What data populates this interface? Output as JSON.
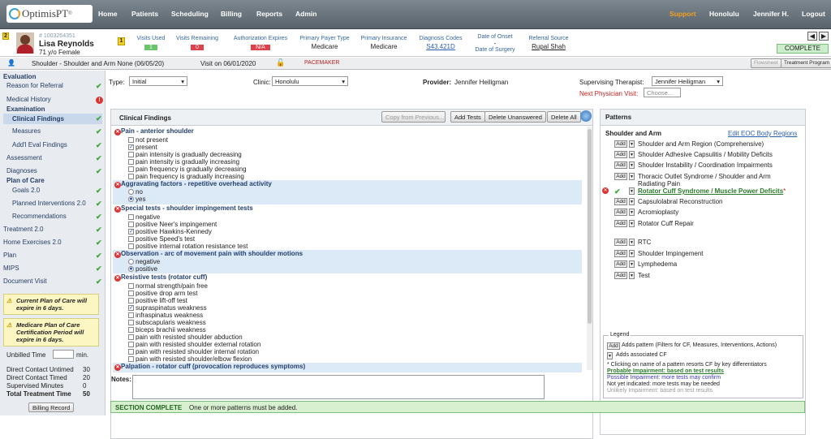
{
  "app": {
    "logo": "OptimisPT",
    "logo_reg": "®",
    "nav": [
      "Home",
      "Patients",
      "Scheduling",
      "Billing",
      "Reports",
      "Admin"
    ],
    "support": "Support",
    "location": "Honolulu",
    "user": "Jennifer H.",
    "logout": "Logout"
  },
  "patient": {
    "flag_num": "2",
    "id": "# 1003264351",
    "name": "Lisa Reynolds",
    "age_sex": "71 y/o Female",
    "visits_used_label": "Visits Used",
    "visits_used": "1",
    "visits_remaining_label": "Visits Remaining",
    "visits_remaining": "0",
    "auth_label": "Authorization Expires",
    "auth": "N/A",
    "payer_label": "Primary Payer Type",
    "payer": "Medicare",
    "insurance_label": "Primary Insurance",
    "insurance": "Medicare",
    "dx_label": "Diagnosis Codes",
    "dx": "S43.421D",
    "onset_label": "Date of Onset",
    "onset": "-",
    "surgery_label": "Date of Surgery",
    "referral_label": "Referral Source",
    "referral": "Rupal Shah",
    "status": "COMPLETE",
    "marker": "1"
  },
  "crumb": {
    "case": "Shoulder - Shoulder and Arm None (06/05/20)",
    "visit": "Visit on 06/01/2020",
    "pacemaker": "PACEMAKER",
    "flowsheet": "Flowsheet",
    "treatment_program": "Treatment Program"
  },
  "sidebar": {
    "evaluation": "Evaluation",
    "reason": "Reason for Referral",
    "history": "Medical History",
    "examination": "Examination",
    "clinical": "Clinical Findings",
    "measures": "Measures",
    "addl": "Add'l Eval Findings",
    "assessment": "Assessment",
    "diagnoses": "Diagnoses",
    "poc": "Plan of Care",
    "goals": "Goals 2.0",
    "planned": "Planned Interventions 2.0",
    "recs": "Recommendations",
    "treatment": "Treatment 2.0",
    "home": "Home Exercises 2.0",
    "plan": "Plan",
    "mips": "MIPS",
    "doc": "Document Visit",
    "warn1": "Current Plan of Care will expire in 6 days.",
    "warn2": "Medicare Plan of Care Certification Period will expire in 6 days.",
    "unbilled": "Unbilled Time",
    "min": "min.",
    "dc_untimed": "Direct Contact Untimed",
    "dc_untimed_v": "30",
    "dc_timed": "Direct Contact Timed",
    "dc_timed_v": "20",
    "supervised": "Supervised Minutes",
    "supervised_v": "0",
    "total": "Total Treatment Time",
    "total_v": "50",
    "billing": "Billing Record"
  },
  "form": {
    "type_label": "Type:",
    "type": "Initial",
    "clinic_label": "Clinic:",
    "clinic": "Honolulu",
    "provider_label": "Provider:",
    "provider": "Jennifer Heiligman",
    "sup_label": "Supervising Therapist:",
    "sup": "Jennifer Heiligman",
    "next_label": "Next Physician Visit:",
    "next_ph": "Choose...",
    "notes_label": "Notes:"
  },
  "findings": {
    "title": "Clinical Findings",
    "copy": "Copy from Previous...",
    "add": "Add Tests",
    "delete_unanswered": "Delete Unanswered",
    "delete_all": "Delete All",
    "groups": [
      {
        "title": "Pain - anterior shoulder",
        "items": [
          "not present",
          "present",
          "pain intensity is gradually decreasing",
          "pain intensity is gradually increasing",
          "pain frequency is gradually decreasing",
          "pain frequency is gradually increasing"
        ]
      },
      {
        "title": "Aggravating factors - repetitive overhead activity",
        "items": [
          "no",
          "yes"
        ]
      },
      {
        "title": "Special tests - shoulder impingement tests",
        "items": [
          "negative",
          "positive Neer's impingement",
          "positive Hawkins-Kennedy",
          "positive Speed's test",
          "positive internal rotation resistance test"
        ]
      },
      {
        "title": "Observation - arc of movement pain with shoulder motions",
        "items": [
          "negative",
          "positive"
        ]
      },
      {
        "title": "Resistive tests (rotator cuff)",
        "items": [
          "normal strength/pain free",
          "positive drop arm test",
          "positive lift-off test",
          "supraspinatus weakness",
          "infraspinatus weakness",
          "subscapularis weakness",
          "biceps brachii weakness",
          "pain with resisted shoulder abduction",
          "pain with resisted shoulder external rotation",
          "pain with resisted shoulder internal rotation",
          "pain with resisted shoulder/elbow flexion"
        ]
      },
      {
        "title": "Palpation - rotator cuff (provocation reproduces symptoms)",
        "items": []
      }
    ]
  },
  "patterns": {
    "title": "Patterns",
    "region": "Shoulder and Arm",
    "edit": "Edit EOC Body Regions",
    "add": "Add",
    "items": [
      "Shoulder and Arm Region (Comprehensive)",
      "Shoulder Adhesive Capsulitis / Mobility Deficits",
      "Shoulder Instability / Coordination Impairments",
      "Thoracic Outlet Syndrome / Shoulder and Arm Radiating Pain",
      "Rotator Cuff Syndrome / Muscle Power Deficits",
      "Capsulolabral Reconstruction",
      "Acromioplasty",
      "Rotator Cuff Repair",
      "RTC",
      "Shoulder Impingement",
      "Lymphedema",
      "Test"
    ],
    "asterisk": "*"
  },
  "legend": {
    "title": "Legend",
    "add_text": "Adds pattern (Filters for CF, Measures, Interventions, Actions)",
    "cf_text": "Adds associated CF",
    "note": "* Clicking on name of a pattern resorts CF by key differentiators",
    "probable": "Probable Impairment: based on test results",
    "possible": "Possible Impairment: more tests may confirm",
    "notyet": "Not yet indicated: more tests may be needed",
    "unlikely": "Unlikely Impairment: based on test results"
  },
  "footer": {
    "status": "SECTION COMPLETE",
    "msg": "One or more patterns must be added."
  }
}
